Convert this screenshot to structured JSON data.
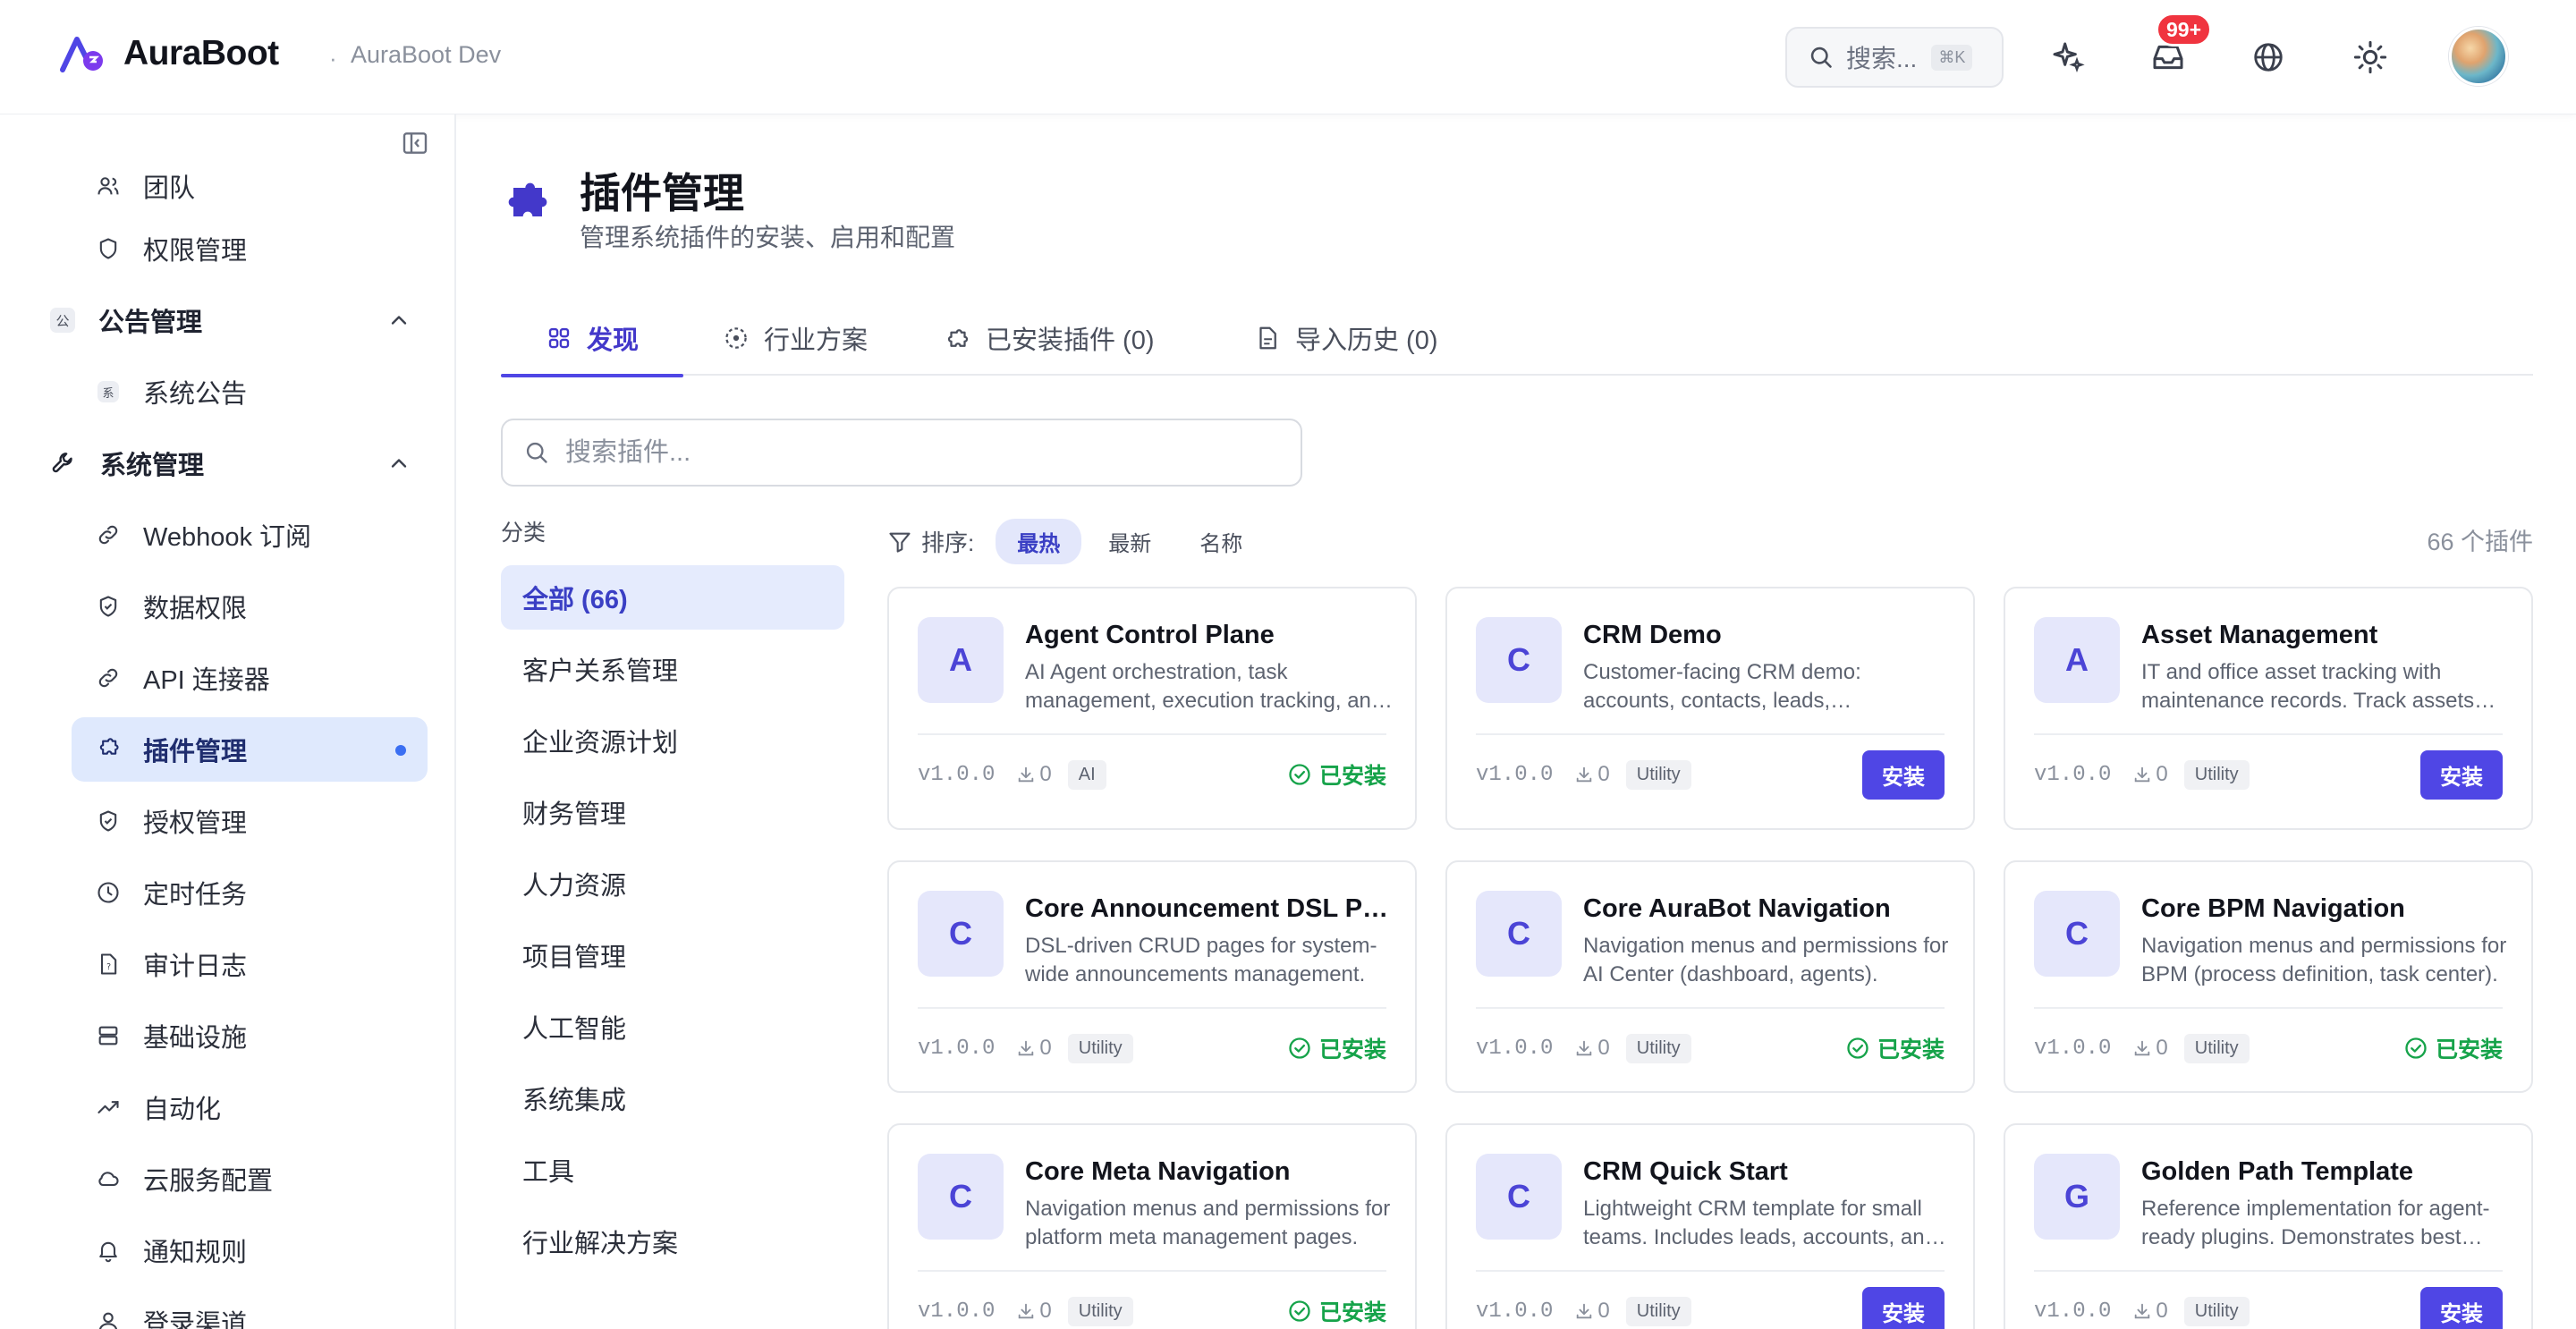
{
  "header": {
    "brand": "AuraBoot",
    "separator": "·",
    "env": "AuraBoot Dev",
    "search_placeholder": "搜索...",
    "search_shortcut": "⌘K",
    "notification_badge": "99+",
    "icons": [
      "sparkle-icon",
      "inbox-icon",
      "globe-icon",
      "sun-icon"
    ]
  },
  "sidebar": {
    "items": [
      {
        "label": "团队",
        "icon": "team-icon"
      },
      {
        "label": "权限管理",
        "icon": "shield-icon"
      },
      {
        "label": "公告管理",
        "icon": "badge-gong",
        "group": true
      },
      {
        "label": "系统公告",
        "icon": "badge-xi"
      },
      {
        "label": "系统管理",
        "icon": "wrench-icon",
        "group": true
      },
      {
        "label": "Webhook 订阅",
        "icon": "link-icon"
      },
      {
        "label": "数据权限",
        "icon": "shield-check-icon"
      },
      {
        "label": "API 连接器",
        "icon": "link-icon"
      },
      {
        "label": "插件管理",
        "icon": "puzzle-icon",
        "active": true
      },
      {
        "label": "授权管理",
        "icon": "shield-check-icon"
      },
      {
        "label": "定时任务",
        "icon": "clock-icon"
      },
      {
        "label": "审计日志",
        "icon": "file-icon"
      },
      {
        "label": "基础设施",
        "icon": "server-icon"
      },
      {
        "label": "自动化",
        "icon": "trend-icon"
      },
      {
        "label": "云服务配置",
        "icon": "cloud-icon"
      },
      {
        "label": "通知规则",
        "icon": "bell-icon"
      },
      {
        "label": "登录渠道",
        "icon": "user-icon"
      }
    ],
    "group_badges": {
      "gong": "公",
      "xi": "系"
    }
  },
  "page": {
    "title": "插件管理",
    "subtitle": "管理系统插件的安装、启用和配置"
  },
  "tabs": [
    {
      "label": "发现",
      "icon": "grid-icon",
      "active": true
    },
    {
      "label": "行业方案",
      "icon": "target-icon"
    },
    {
      "label": "已安装插件 (0)",
      "icon": "puzzle-outline-icon"
    },
    {
      "label": "导入历史 (0)",
      "icon": "document-icon"
    }
  ],
  "search": {
    "placeholder": "搜索插件...",
    "value": ""
  },
  "categories": {
    "title": "分类",
    "items": [
      "全部 (66)",
      "客户关系管理",
      "企业资源计划",
      "财务管理",
      "人力资源",
      "项目管理",
      "人工智能",
      "系统集成",
      "工具",
      "行业解决方案"
    ]
  },
  "sort": {
    "label": "排序:",
    "options": [
      "最热",
      "最新",
      "名称"
    ],
    "active": "最热",
    "count": "66 个插件"
  },
  "plugins": [
    {
      "letter": "A",
      "title": "Agent Control Plane",
      "desc": "AI Agent orchestration, task management, execution tracking, and more.",
      "version": "v1.0.0",
      "downloads": "0",
      "tag": "AI",
      "status": "installed"
    },
    {
      "letter": "C",
      "title": "CRM Demo",
      "desc": "Customer-facing CRM demo: accounts, contacts, leads, opportunities.",
      "version": "v1.0.0",
      "downloads": "0",
      "tag": "Utility",
      "status": "install"
    },
    {
      "letter": "A",
      "title": "Asset Management",
      "desc": "IT and office asset tracking with maintenance records. Track assets across locations.",
      "version": "v1.0.0",
      "downloads": "0",
      "tag": "Utility",
      "status": "install"
    },
    {
      "letter": "C",
      "title": "Core Announcement DSL Pages",
      "desc": "DSL-driven CRUD pages for system-wide announcements management.",
      "version": "v1.0.0",
      "downloads": "0",
      "tag": "Utility",
      "status": "installed"
    },
    {
      "letter": "C",
      "title": "Core AuraBot Navigation",
      "desc": "Navigation menus and permissions for AI Center (dashboard, agents).",
      "version": "v1.0.0",
      "downloads": "0",
      "tag": "Utility",
      "status": "installed"
    },
    {
      "letter": "C",
      "title": "Core BPM Navigation",
      "desc": "Navigation menus and permissions for BPM (process definition, task center).",
      "version": "v1.0.0",
      "downloads": "0",
      "tag": "Utility",
      "status": "installed"
    },
    {
      "letter": "C",
      "title": "Core Meta Navigation",
      "desc": "Navigation menus and permissions for platform meta management pages.",
      "version": "v1.0.0",
      "downloads": "0",
      "tag": "Utility",
      "status": "installed"
    },
    {
      "letter": "C",
      "title": "CRM Quick Start",
      "desc": "Lightweight CRM template for small teams. Includes leads, accounts, and deals.",
      "version": "v1.0.0",
      "downloads": "0",
      "tag": "Utility",
      "status": "install"
    },
    {
      "letter": "G",
      "title": "Golden Path Template",
      "desc": "Reference implementation for agent-ready plugins. Demonstrates best practices.",
      "version": "v1.0.0",
      "downloads": "0",
      "tag": "Utility",
      "status": "install"
    }
  ],
  "labels": {
    "installed": "已安装",
    "install": "安装"
  },
  "colors": {
    "accent": "#4f46e5",
    "installed": "#16a34a",
    "badge": "#f0343f",
    "active_nav": "#dfe9fd"
  }
}
